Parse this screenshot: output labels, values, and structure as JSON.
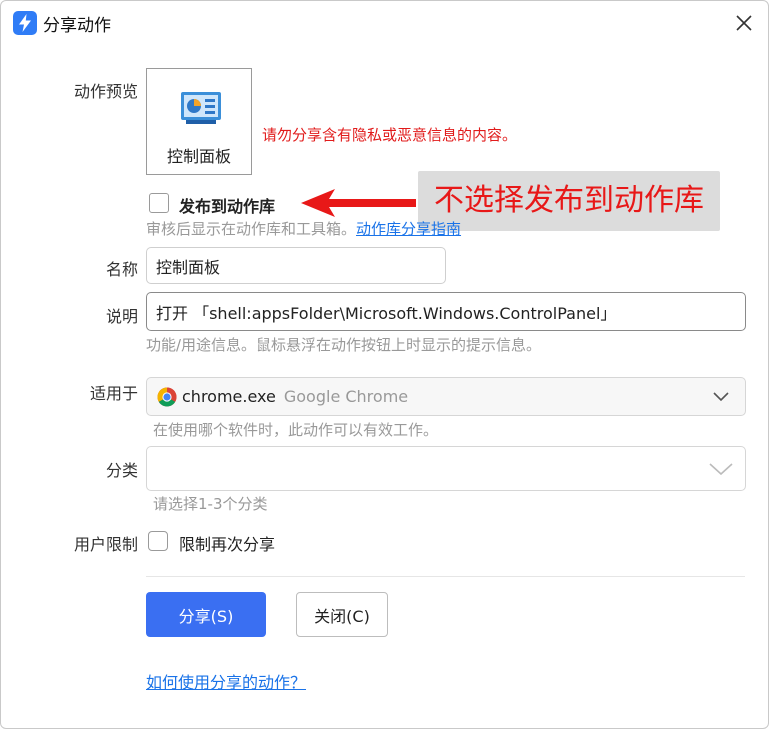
{
  "window": {
    "title": "分享动作",
    "icon": "lightning-bolt-icon",
    "close_icon": "close-icon"
  },
  "preview": {
    "label": "动作预览",
    "card_text": "控制面板",
    "card_icon": "control-panel-icon",
    "warning": "请勿分享含有隐私或恶意信息的内容。"
  },
  "publish": {
    "checkbox_label": "发布到动作库",
    "checked": false,
    "hint": "审核后显示在动作库和工具箱。",
    "link_text": "动作库分享指南"
  },
  "annotation": {
    "text": "不选择发布到动作库",
    "color": "#e81818"
  },
  "name": {
    "label": "名称",
    "value": "控制面板"
  },
  "description": {
    "label": "说明",
    "value": "打开 「shell:appsFolder\\Microsoft.Windows.ControlPanel」",
    "hint": "功能/用途信息。鼠标悬浮在动作按钮上时显示的提示信息。"
  },
  "applies_to": {
    "label": "适用于",
    "selected_exe": "chrome.exe",
    "selected_app": "Google Chrome",
    "icon": "chrome-icon",
    "hint": "在使用哪个软件时，此动作可以有效工作。"
  },
  "category": {
    "label": "分类",
    "value": "",
    "hint": "请选择1-3个分类"
  },
  "user_limit": {
    "label": "用户限制",
    "checkbox_label": "限制再次分享",
    "checked": false
  },
  "buttons": {
    "share": "分享(S)",
    "close": "关闭(C)"
  },
  "help_link": "如何使用分享的动作？",
  "colors": {
    "primary": "#3a6ff2",
    "link": "#1a73e8",
    "warning": "#e11b1b"
  }
}
